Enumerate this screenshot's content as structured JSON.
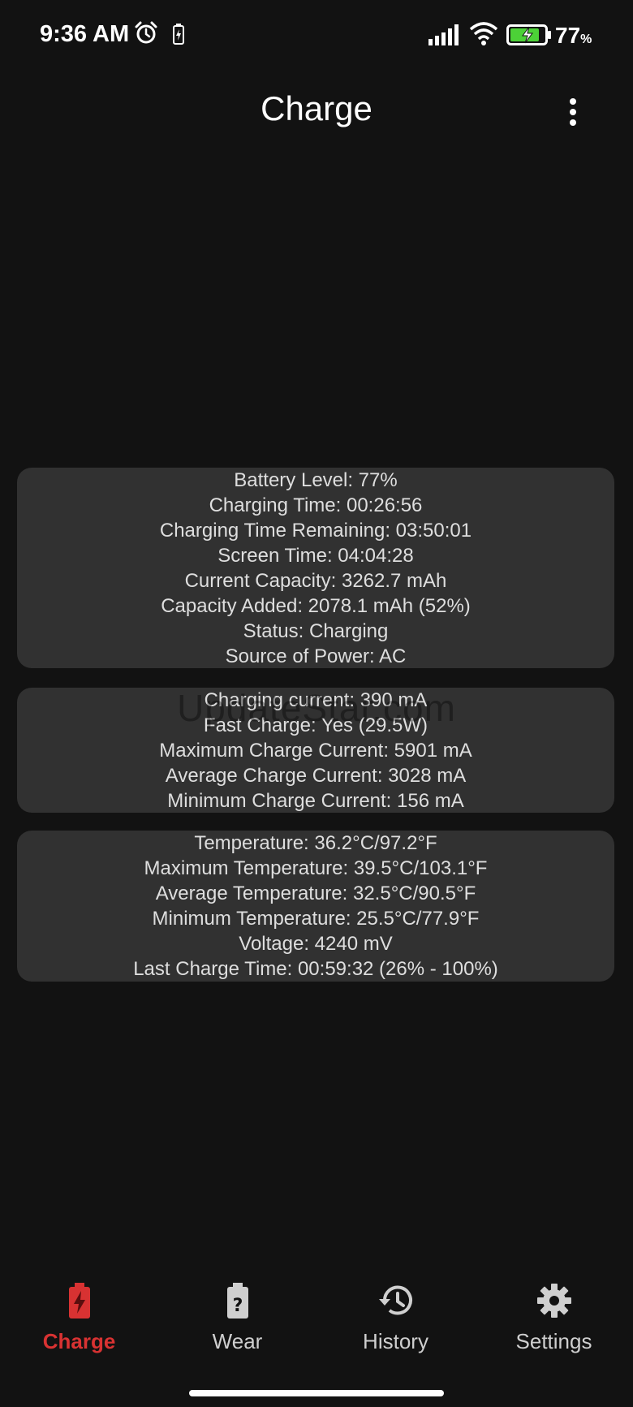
{
  "status_bar": {
    "time": "9:36 AM",
    "battery_percent": "77",
    "battery_unit": "%"
  },
  "app": {
    "title": "Charge"
  },
  "cards": [
    {
      "lines": [
        "Battery Level: 77%",
        "Charging Time: 00:26:56",
        "Charging Time Remaining: 03:50:01",
        "Screen Time: 04:04:28",
        "Current Capacity: 3262.7 mAh",
        "Capacity Added: 2078.1 mAh (52%)",
        "Status: Charging",
        "Source of Power: AC"
      ]
    },
    {
      "lines": [
        "Charging current: 390 mA",
        "Fast Charge: Yes (29.5W)",
        "Maximum Charge Current: 5901 mA",
        "Average Charge Current: 3028 mA",
        "Minimum Charge Current: 156 mA"
      ]
    },
    {
      "lines": [
        "Temperature: 36.2°C/97.2°F",
        "Maximum Temperature: 39.5°C/103.1°F",
        "Average Temperature: 32.5°C/90.5°F",
        "Minimum Temperature: 25.5°C/77.9°F",
        "Voltage: 4240 mV",
        "Last Charge Time: 00:59:32 (26% - 100%)"
      ]
    }
  ],
  "watermark": "UpdateStar.com",
  "nav": {
    "items": [
      {
        "label": "Charge",
        "icon": "battery-charging-icon",
        "active": true
      },
      {
        "label": "Wear",
        "icon": "battery-question-icon",
        "active": false
      },
      {
        "label": "History",
        "icon": "history-icon",
        "active": false
      },
      {
        "label": "Settings",
        "icon": "gear-icon",
        "active": false
      }
    ],
    "active_color": "#d83232"
  }
}
